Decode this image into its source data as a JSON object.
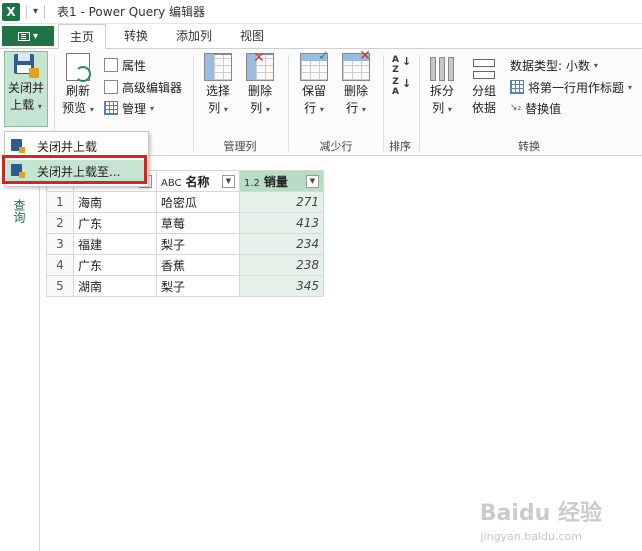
{
  "window": {
    "title": "表1 - Power Query 编辑器"
  },
  "tabs": [
    "主页",
    "转换",
    "添加列",
    "视图"
  ],
  "ribbon": {
    "close_load": {
      "line1": "关闭并",
      "line2": "上载"
    },
    "refresh": {
      "line1": "刷新",
      "line2": "预览"
    },
    "properties": "属性",
    "advanced_editor": "高级编辑器",
    "manage": "管理",
    "choose_columns": {
      "line1": "选择",
      "line2": "列"
    },
    "remove_columns": {
      "line1": "删除",
      "line2": "列"
    },
    "keep_rows": {
      "line1": "保留",
      "line2": "行"
    },
    "remove_rows": {
      "line1": "删除",
      "line2": "行"
    },
    "split_column": {
      "line1": "拆分",
      "line2": "列"
    },
    "group_by": {
      "line1": "分组",
      "line2": "依据"
    },
    "data_type": "数据类型: 小数",
    "first_row_header": "将第一行用作标题",
    "replace_values": "替换值",
    "groups": {
      "manage_columns": "管理列",
      "reduce_rows": "减少行",
      "sort": "排序",
      "transform": "转换"
    }
  },
  "dropdown": {
    "items": [
      "关闭并上载",
      "关闭并上载至..."
    ],
    "highlighted_index": 1
  },
  "sidebar": {
    "label": "查询"
  },
  "table": {
    "columns": [
      {
        "type": "ABC",
        "name": "",
        "selected": false
      },
      {
        "type": "ABC",
        "name": "名称",
        "selected": false
      },
      {
        "type": "1.2",
        "name": "销量",
        "selected": true
      }
    ],
    "rows": [
      {
        "n": "1",
        "c1": "海南",
        "c2": "哈密瓜",
        "c3": "271"
      },
      {
        "n": "2",
        "c1": "广东",
        "c2": "草莓",
        "c3": "413"
      },
      {
        "n": "3",
        "c1": "福建",
        "c2": "梨子",
        "c3": "234"
      },
      {
        "n": "4",
        "c1": "广东",
        "c2": "香蕉",
        "c3": "238"
      },
      {
        "n": "5",
        "c1": "湖南",
        "c2": "梨子",
        "c3": "345"
      }
    ]
  },
  "watermark": {
    "brand": "Baidu 经验",
    "url": "jingyan.baidu.com"
  },
  "colors": {
    "accent": "#217346",
    "highlight": "#c6e4d2",
    "annotation": "#d2261e"
  }
}
